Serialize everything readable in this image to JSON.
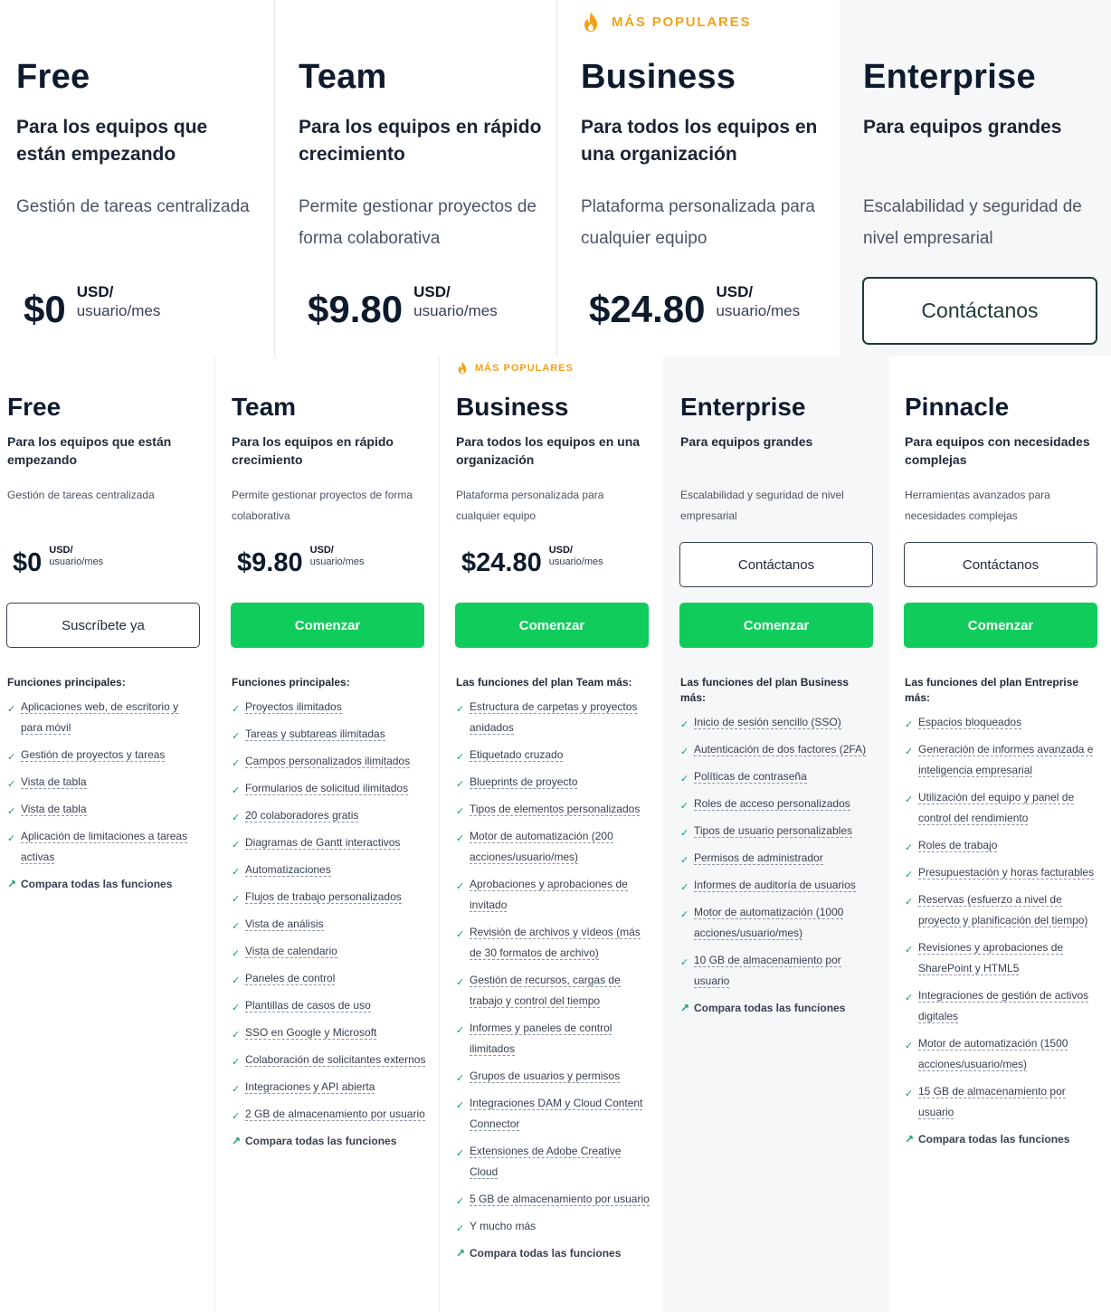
{
  "top": {
    "popular_label": "MÁS POPULARES",
    "plans": [
      {
        "name": "Free",
        "subtitle": "Para los equipos que están empezando",
        "description": "Gestión de tareas centralizada",
        "price": "$0",
        "unit_top": "USD/",
        "unit_bottom": "usuario/mes"
      },
      {
        "name": "Team",
        "subtitle": "Para los equipos en rápido crecimiento",
        "description": "Permite gestionar proyectos de forma colaborativa",
        "price": "$9.80",
        "unit_top": "USD/",
        "unit_bottom": "usuario/mes"
      },
      {
        "name": "Business",
        "subtitle": "Para todos los equipos en una organización",
        "description": "Plataforma personalizada para cualquier equipo",
        "price": "$24.80",
        "unit_top": "USD/",
        "unit_bottom": "usuario/mes"
      },
      {
        "name": "Enterprise",
        "subtitle": "Para equipos grandes",
        "description": "Escalabilidad y seguridad de nivel empresarial",
        "contact_label": "Contáctanos"
      }
    ]
  },
  "bottom": {
    "popular_label": "MÁS POPULARES",
    "compare_label": "Compara todas las funciones",
    "plans": [
      {
        "name": "Free",
        "subtitle": "Para los equipos que están empezando",
        "description": "Gestión de tareas centralizada",
        "price": "$0",
        "unit_top": "USD/",
        "unit_bottom": "usuario/mes",
        "cta": "Suscríbete ya",
        "features_heading": "Funciones principales:",
        "features": [
          "Aplicaciones web, de escritorio y para móvil",
          "Gestión de proyectos y tareas",
          "Vista de tabla",
          "Vista de tabla",
          "Aplicación de limitaciones a tareas activas"
        ]
      },
      {
        "name": "Team",
        "subtitle": "Para los equipos en rápido crecimiento",
        "description": "Permite gestionar proyectos de forma colaborativa",
        "price": "$9.80",
        "unit_top": "USD/",
        "unit_bottom": "usuario/mes",
        "cta": "Comenzar",
        "features_heading": "Funciones principales:",
        "features": [
          "Proyectos ilimitados",
          "Tareas y subtareas ilimitadas",
          "Campos personalizados ilimitados",
          "Formularios de solicitud ilimitados",
          "20 colaboradores gratis",
          "Diagramas de Gantt interactivos",
          "Automatizaciones",
          "Flujos de trabajo personalizados",
          "Vista de análisis",
          "Vista de calendario",
          "Paneles de control",
          "Plantillas de casos de uso",
          "SSO en Google y Microsoft",
          "Colaboración de solicitantes externos",
          "Integraciones y API abierta",
          "2 GB de almacenamiento por usuario"
        ]
      },
      {
        "name": "Business",
        "subtitle": "Para todos los equipos en una organización",
        "description": "Plataforma personalizada para cualquier equipo",
        "price": "$24.80",
        "unit_top": "USD/",
        "unit_bottom": "usuario/mes",
        "cta": "Comenzar",
        "features_heading": "Las funciones del plan Team más:",
        "features": [
          "Estructura de carpetas y proyectos anidados",
          "Etiquetado cruzado",
          "Blueprints de proyecto",
          "Tipos de elementos personalizados",
          "Motor de automatización (200 acciones/usuario/mes)",
          "Aprobaciones y aprobaciones de invitado",
          "Revisión de archivos y vídeos (más de 30 formatos de archivo)",
          "Gestión de recursos, cargas de trabajo y control del tiempo",
          "Informes y paneles de control ilimitados",
          "Grupos de usuarios y permisos",
          "Integraciones DAM y Cloud Content Connector",
          "Extensiones de Adobe Creative Cloud",
          "5 GB de almacenamiento por usuario",
          "Y mucho más"
        ]
      },
      {
        "name": "Enterprise",
        "subtitle": "Para equipos grandes",
        "description": "Escalabilidad y seguridad de nivel empresarial",
        "contact_label": "Contáctanos",
        "cta": "Comenzar",
        "features_heading": "Las funciones del plan Business más:",
        "features": [
          "Inicio de sesión sencillo (SSO)",
          "Autenticación de dos factores (2FA)",
          "Políticas de contraseña",
          "Roles de acceso personalizados",
          "Tipos de usuario personalizables",
          "Permisos de administrador",
          "Informes de auditoría de usuarios",
          "Motor de automatización (1000 acciones/usuario/mes)",
          "10 GB de almacenamiento por usuario"
        ]
      },
      {
        "name": "Pinnacle",
        "subtitle": "Para equipos con necesidades complejas",
        "description": "Herramientas avanzados para necesidades complejas",
        "contact_label": "Contáctanos",
        "cta": "Comenzar",
        "features_heading": "Las funciones del plan Entreprise más:",
        "features": [
          "Espacios bloqueados",
          "Generación de informes avanzada e inteligencia empresarial",
          "Utilización del equipo y panel de control del rendimiento",
          "Roles de trabajo",
          "Presupuestación y horas facturables",
          "Reservas (esfuerzo a nivel de proyecto y planificación del tiempo)",
          "Revisiones y aprobaciones de SharePoint y HTML5",
          "Integraciones de gestión de activos digitales",
          "Motor de automatización (1500 acciones/usuario/mes)",
          "15 GB de almacenamiento por usuario"
        ]
      }
    ]
  },
  "colors": {
    "accent_green": "#10cc5a",
    "popular_orange": "#f2a11a",
    "dark_text": "#0e1b2d",
    "enterprise_bg": "#f6f7f9"
  },
  "icons": {
    "popular": "flame-icon",
    "feature": "check-icon",
    "compare": "arrow-up-right-icon"
  }
}
